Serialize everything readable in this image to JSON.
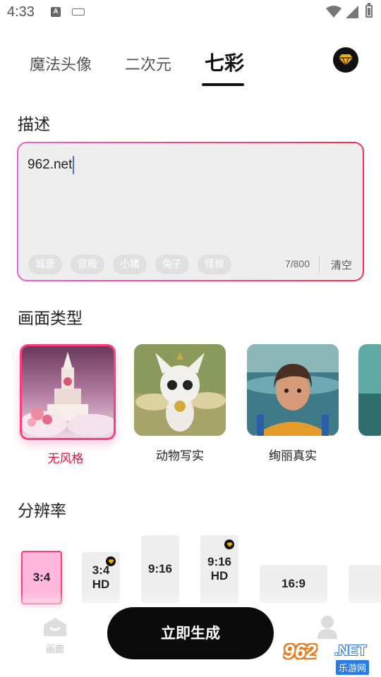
{
  "status_bar": {
    "time": "4:33",
    "a_badge": "A"
  },
  "tabs": [
    {
      "label": "魔法头像",
      "active": false
    },
    {
      "label": "二次元",
      "active": false
    },
    {
      "label": "七彩",
      "active": true
    }
  ],
  "description": {
    "title": "描述",
    "value": "962.net",
    "chips": [
      "城堡",
      "宫殿",
      "小猪",
      "兔子",
      "怪兽"
    ],
    "counter": "7/800",
    "clear_label": "清空"
  },
  "styles": {
    "title": "画面类型",
    "items": [
      {
        "label": "无风格",
        "selected": true
      },
      {
        "label": "动物写实",
        "selected": false
      },
      {
        "label": "绚丽真实",
        "selected": false
      }
    ]
  },
  "resolution": {
    "title": "分辨率",
    "options": [
      {
        "line1": "3:4",
        "line2": "",
        "vip": false,
        "selected": true
      },
      {
        "line1": "3:4",
        "line2": "HD",
        "vip": true,
        "selected": false
      },
      {
        "line1": "9:16",
        "line2": "",
        "vip": false,
        "selected": false
      },
      {
        "line1": "9:16",
        "line2": "HD",
        "vip": true,
        "selected": false
      },
      {
        "line1": "16:9",
        "line2": "",
        "vip": false,
        "selected": false
      }
    ]
  },
  "bottom_nav": {
    "gallery_label": "画廊",
    "generate_label": "立即生成"
  },
  "watermark": {
    "number": "962",
    "net": ".NET",
    "sub": "乐游网"
  },
  "colors": {
    "accent": "#ff3d7a",
    "selected_text": "#e8123c",
    "vip_gold": "#f5b100"
  }
}
